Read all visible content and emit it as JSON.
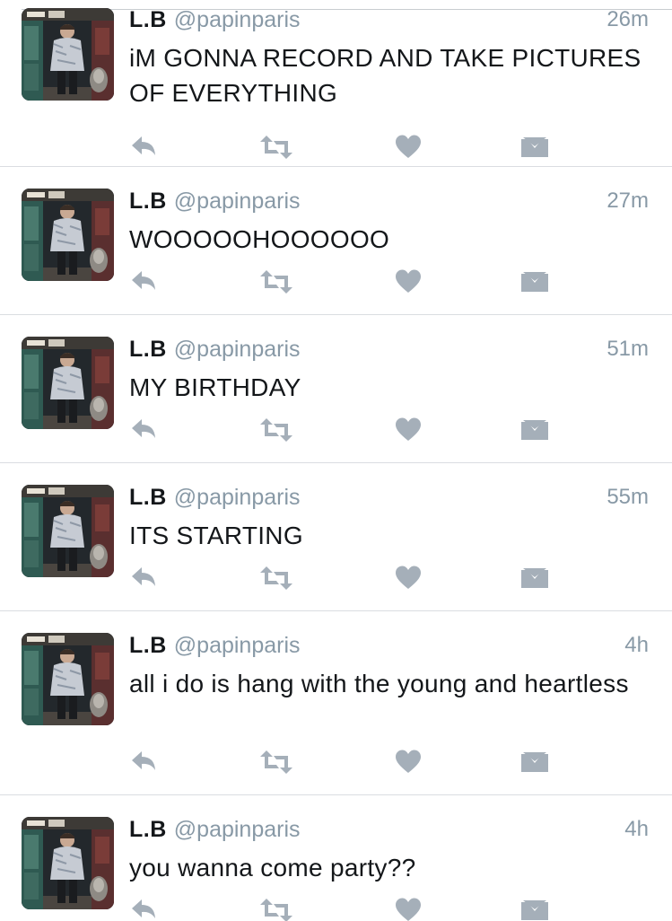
{
  "colors": {
    "background": "#ffffff",
    "text": "#14171a",
    "secondary_text": "#8899a6",
    "action_icon": "#a5afb9",
    "separator": "#dadde1"
  },
  "icons": {
    "reply": "reply-arrow-icon",
    "retweet": "retweet-arrows-icon",
    "like": "heart-icon",
    "direct_message": "envelope-icon"
  },
  "tweets": [
    {
      "name": "L.B",
      "handle": "@papinparis",
      "time": "26m",
      "text": "iM GONNA RECORD AND TAKE PICTURES OF EVERYTHING"
    },
    {
      "name": "L.B",
      "handle": "@papinparis",
      "time": "27m",
      "text": "WOOOOOHOOOOOO"
    },
    {
      "name": "L.B",
      "handle": "@papinparis",
      "time": "51m",
      "text": "MY BIRTHDAY"
    },
    {
      "name": "L.B",
      "handle": "@papinparis",
      "time": "55m",
      "text": "ITS STARTING"
    },
    {
      "name": "L.B",
      "handle": "@papinparis",
      "time": "4h",
      "text": "all i do is hang with the young and heartless"
    },
    {
      "name": "L.B",
      "handle": "@papinparis",
      "time": "4h",
      "text": "you wanna come party??"
    }
  ]
}
